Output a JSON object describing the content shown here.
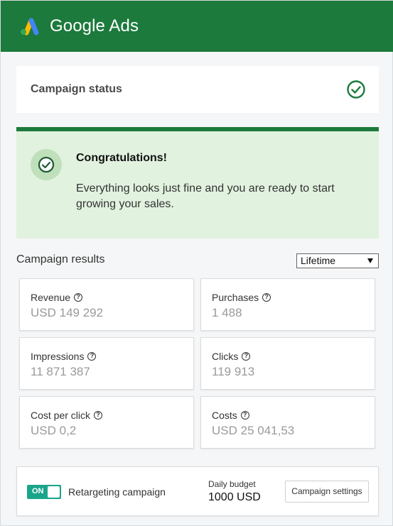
{
  "header": {
    "brand": "Google Ads",
    "colors": {
      "bar": "#1c7a3c",
      "logo_blue": "#4285f4",
      "logo_yellow": "#fbbc04",
      "logo_green": "#34a853"
    },
    "logo_icon": "google-ads-logo"
  },
  "status_card": {
    "title": "Campaign status",
    "icon": "check-circle-icon"
  },
  "congrats": {
    "title": "Congratulations!",
    "message": "Everything looks just fine and you are ready to start growing your sales.",
    "icon": "check-circle-icon",
    "colors": {
      "background": "#e1f2df",
      "accent": "#1c7a3c"
    }
  },
  "results": {
    "title": "Campaign results",
    "period": "Lifetime",
    "metrics": [
      {
        "label": "Revenue",
        "value": "USD 149 292"
      },
      {
        "label": "Purchases",
        "value": "1 488"
      },
      {
        "label": "Impressions",
        "value": "11 871 387"
      },
      {
        "label": "Clicks",
        "value": "119 913"
      },
      {
        "label": "Cost per click",
        "value": "USD 0,2"
      },
      {
        "label": "Costs",
        "value": "USD 25 041,53"
      }
    ]
  },
  "footer": {
    "toggle_state": "ON",
    "toggle_color": "#1aa58a",
    "retargeting_label": "Retargeting campaign",
    "budget_label": "Daily budget",
    "budget_value": "1000 USD",
    "settings_button": "Campaign settings"
  }
}
